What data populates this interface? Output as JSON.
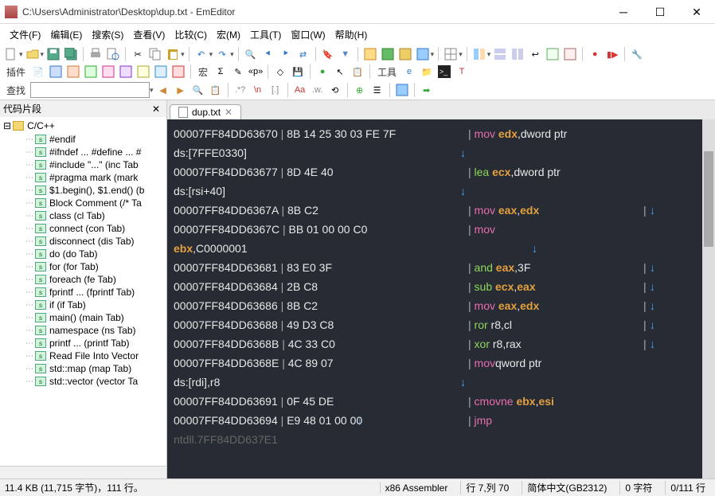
{
  "window": {
    "title": "C:\\Users\\Administrator\\Desktop\\dup.txt - EmEditor"
  },
  "menu": [
    "文件(F)",
    "编辑(E)",
    "搜索(S)",
    "查看(V)",
    "比较(C)",
    "宏(M)",
    "工具(T)",
    "窗口(W)",
    "帮助(H)"
  ],
  "toolbar": {
    "pluginsLabel": "插件",
    "macroLabel": "宏",
    "sigma": "Σ",
    "pp": "«p»",
    "toolsLabel": "工具",
    "findLabel": "查找",
    "findPlaceholder": "",
    "t3": {
      "a": ".*?",
      "n": "\\n",
      "b": "[.]",
      "Aa": "Aa",
      "w": ".w.",
      "bk": "⟲"
    }
  },
  "side": {
    "title": "代码片段",
    "folder": "C/C++",
    "items": [
      "#endif",
      "#ifndef ... #define ... #",
      "#include \"...\"  (inc Tab",
      "#pragma mark  (mark",
      "$1.begin(), $1.end()  (b",
      "Block Comment  (/* Ta",
      "class  (cl Tab)",
      "connect  (con Tab)",
      "disconnect  (dis Tab)",
      "do  (do Tab)",
      "for  (for Tab)",
      "foreach  (fe Tab)",
      "fprintf ...  (fprintf Tab)",
      "if  (if Tab)",
      "main()  (main Tab)",
      "namespace  (ns Tab)",
      "printf ...  (printf Tab)",
      "Read File Into Vector",
      "std::map  (map Tab)",
      "std::vector  (vector Ta"
    ]
  },
  "tab": {
    "label": "dup.txt"
  },
  "code": {
    "crlf": "↓",
    "lines": [
      {
        "addr": "00007FF84DD63670",
        "hex": "8B 14 25 30 03 FE 7F",
        "col": 610,
        "mn": "mov",
        "mncls": "mn-default",
        "reg": "edx",
        "regcls": "reg-orange",
        "tail": ",dword ptr",
        "cr": false
      },
      {
        "cont": "ds:[7FFE0330]",
        "ccol": 360,
        "ccr": true
      },
      {
        "addr": "00007FF84DD63677",
        "hex": "8D 4E 40",
        "col": 590,
        "mn": "lea",
        "mncls": "mn-green",
        "reg": "ecx",
        "regcls": "reg-orange",
        "tail": ",dword ptr",
        "cr": false
      },
      {
        "cont": "ds:[rsi+40]",
        "ccol": 360,
        "ccr": true
      },
      {
        "addr": "00007FF84DD6367A",
        "hex": "8B C2",
        "col": 590,
        "mn": "mov",
        "mncls": "mn-default",
        "reg": "eax",
        "regcls": "reg-orange",
        "tail": ",",
        "tail2": "edx",
        "tail2cls": "reg-orange",
        "farcr": 820
      },
      {
        "addr": "00007FF84DD6367C",
        "hex": "BB 01 00 00 C0",
        "col": 620,
        "mn": "mov",
        "mncls": "mn-default",
        "reg": "",
        "tail": "",
        "cr": false
      },
      {
        "cont": "",
        "contreg": "ebx",
        "contregcls": "reg-orange",
        "conttail": ",C0000001",
        "ccol": 450,
        "ccr": true
      },
      {
        "addr": "00007FF84DD63681",
        "hex": "83 E0 3F",
        "col": 590,
        "mn": "and",
        "mncls": "mn-green",
        "reg": "eax",
        "regcls": "reg-orange",
        "tail": ",3F",
        "farcr": 820
      },
      {
        "addr": "00007FF84DD63684",
        "hex": "2B C8",
        "col": 590,
        "mn": "sub",
        "mncls": "mn-green",
        "reg": "ecx",
        "regcls": "reg-orange",
        "tail": ",",
        "tail2": "eax",
        "tail2cls": "reg-orange",
        "farcr": 820
      },
      {
        "addr": "00007FF84DD63686",
        "hex": "8B C2",
        "col": 590,
        "mn": "mov",
        "mncls": "mn-default",
        "reg": "eax",
        "regcls": "reg-orange",
        "tail": ",",
        "tail2": "edx",
        "tail2cls": "reg-orange",
        "farcr": 820
      },
      {
        "addr": "00007FF84DD63688",
        "hex": "49 D3 C8",
        "col": 600,
        "mn": "ror",
        "mncls": "mn-green",
        "reg": "r8,cl",
        "regcls": "reg-plain",
        "tail": "",
        "farcr": 820
      },
      {
        "addr": "00007FF84DD6368B",
        "hex": "4C 33 C0",
        "col": 600,
        "mn": "xor",
        "mncls": "mn-green",
        "reg": "r8,rax",
        "regcls": "reg-plain",
        "tail": "",
        "farcr": 820
      },
      {
        "addr": "00007FF84DD6368E",
        "hex": "4C 89 07",
        "col": 600,
        "mn": "mov",
        "mncls": "mn-default",
        "reg": "",
        "tail": "qword ptr",
        "cr": false
      },
      {
        "cont": "ds:[rdi],r8",
        "ccol": 360,
        "ccr": true
      },
      {
        "addr": "00007FF84DD63691",
        "hex": "0F 45 DE",
        "col": 600,
        "mn": "cmovne",
        "mncls": "mn-default",
        "reg": "ebx",
        "regcls": "reg-orange",
        "tail": ",",
        "tail2": "esi",
        "tail2cls": "reg-orange",
        "cr": false
      },
      {
        "cont": "",
        "ccol": 230,
        "ccr": true
      },
      {
        "addr": "00007FF84DD63694",
        "hex": "E9 48 01 00 00",
        "col": 610,
        "mn": "jmp",
        "mncls": "mn-default",
        "reg": "",
        "tail": "",
        "cr": false
      },
      {
        "frag": "ntdll.7FF84DD637E1"
      }
    ]
  },
  "status": {
    "left": "11.4 KB (11,715 字节)，111 行。",
    "lang": "x86 Assembler",
    "pos": "行 7,列 70",
    "enc": "简体中文(GB2312)",
    "chars": "0 字符",
    "lines": "0/111 行"
  }
}
